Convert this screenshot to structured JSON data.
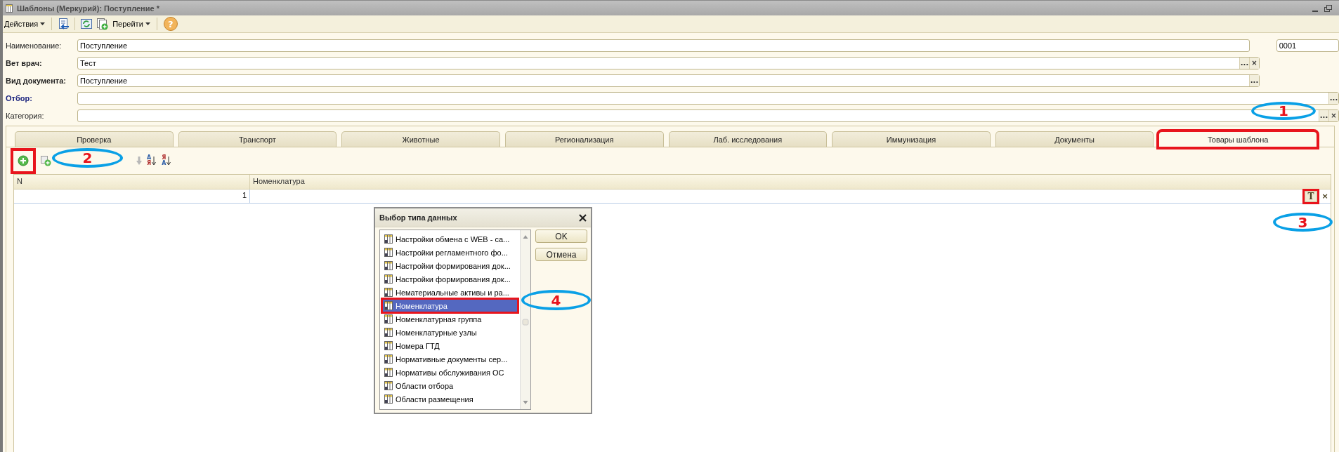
{
  "window": {
    "title": "Шаблоны (Меркурий): Поступление *"
  },
  "toolbar": {
    "actions_menu": "Действия",
    "goto_menu": "Перейти",
    "help": "?"
  },
  "table_toolbar": {
    "sort_buttons": [
      [
        "A",
        "Я"
      ],
      [
        "Я",
        "A"
      ]
    ]
  },
  "form": {
    "fields": [
      {
        "label": "Наименование:",
        "kind": "plain",
        "value": "Поступление",
        "code": "0001"
      },
      {
        "label": "Вет врач:",
        "kind": "required",
        "value": "Тест",
        "buttons": [
          "...",
          "×"
        ]
      },
      {
        "label": "Вид документа:",
        "kind": "required",
        "value": "Поступление",
        "buttons": [
          "..."
        ]
      },
      {
        "label": "Отбор:",
        "kind": "link",
        "buttons": [
          "..."
        ]
      },
      {
        "label": "Категория:",
        "kind": "plain",
        "buttons": [
          "...",
          "×"
        ]
      }
    ]
  },
  "tabs": [
    {
      "label": "Проверка",
      "selected": false
    },
    {
      "label": "Транспорт",
      "selected": false
    },
    {
      "label": "Животные",
      "selected": false
    },
    {
      "label": "Регионализация",
      "selected": false
    },
    {
      "label": "Лаб. исследования",
      "selected": false
    },
    {
      "label": "Иммунизация",
      "selected": false
    },
    {
      "label": "Документы",
      "selected": false
    },
    {
      "label": "Товары шаблона",
      "selected": true
    }
  ],
  "table": {
    "columns": [
      "N",
      "Номенклатура"
    ],
    "rows": [
      {
        "n": "1",
        "buttons": [
          "T",
          "×"
        ]
      }
    ]
  },
  "dialog": {
    "title": "Выбор типа данных",
    "items": [
      {
        "label": "Настройки обмена с WEB - са...",
        "selected": false
      },
      {
        "label": "Настройки регламентного фо...",
        "selected": false
      },
      {
        "label": "Настройки формирования док...",
        "selected": false
      },
      {
        "label": "Настройки формирования док...",
        "selected": false
      },
      {
        "label": "Нематериальные активы и ра...",
        "selected": false
      },
      {
        "label": "Номенклатура",
        "selected": true
      },
      {
        "label": "Номенклатурная группа",
        "selected": false
      },
      {
        "label": "Номенклатурные узлы",
        "selected": false
      },
      {
        "label": "Номера ГТД",
        "selected": false
      },
      {
        "label": "Нормативные документы сер...",
        "selected": false
      },
      {
        "label": "Нормативы обслуживания ОС",
        "selected": false
      },
      {
        "label": "Области отбора",
        "selected": false
      },
      {
        "label": "Области размещения",
        "selected": false
      }
    ],
    "buttons": [
      "OK",
      "Отмена"
    ]
  },
  "annotations": [
    {
      "label": "1"
    },
    {
      "label": "2"
    },
    {
      "label": "3"
    },
    {
      "label": "4"
    }
  ]
}
